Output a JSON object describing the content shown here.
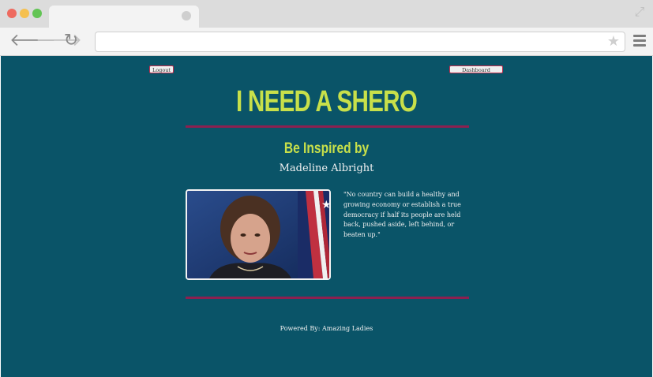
{
  "page": {
    "logout_label": "Logout",
    "dashboard_label": "Dashboard",
    "title": "I NEED A SHERO",
    "subtitle": "Be Inspired by",
    "hero_name": "Madeline Albright",
    "quote": "\"No country can build a healthy and growing economy or establish a true democracy if half its people are held back, pushed aside, left behind, or beaten up.\"",
    "footer": "Powered By: Amazing Ladies"
  },
  "colors": {
    "background": "#0a5468",
    "accent": "#c8e04a",
    "divider": "#8b2050"
  },
  "icons": {
    "back": "back-arrow-icon",
    "forward": "forward-arrow-icon",
    "reload": "reload-icon",
    "star": "star-icon",
    "menu": "hamburger-menu-icon",
    "expand": "expand-icon"
  }
}
